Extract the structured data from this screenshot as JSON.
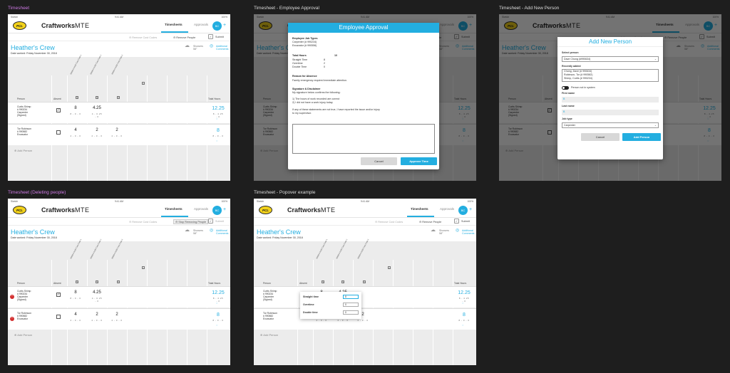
{
  "labels": {
    "f1": "Timesheet",
    "f2": "Timesheet - Employee Approval",
    "f3": "Timesheet - Add New Person",
    "f4": "Timesheet (Deleting people)",
    "f5": "Timesheet - Popover example"
  },
  "app": {
    "status_left": "Sketch",
    "status_time": "9:41 AM",
    "status_right": "100%",
    "logo": "PCL",
    "brand_bold": "Craftworks",
    "brand_light": "MTE",
    "tab_timesheets": "Timesheets",
    "tab_approvals": "Approvals",
    "avatar": "BC",
    "plus": "+"
  },
  "toolbar": {
    "remove_cost": "Remove Cost Codes",
    "remove_people": "Remove People",
    "stop_removing": "Stop Removing People",
    "submit": "Submit"
  },
  "crew": {
    "title": "Heather's Crew",
    "date": "Date worked: Friday November 30, 2018",
    "weather_1": "Showers",
    "weather_2": "58°",
    "comments_1": "Additional",
    "comments_2": "Comments"
  },
  "grid": {
    "person": "Person",
    "absent": "Absent",
    "total": "Total Hours",
    "cc1": "30MM-0-0100 Cost Code 1",
    "cc2": "30MM-0-0200 Cost Code 2",
    "cc3": "30MM-0-0300 Cost Code 3",
    "add_person": "Add Person"
  },
  "rows": [
    {
      "name": "Curtis Shimp",
      "id": "# 990234",
      "trade": "Carpenter",
      "note": "(Signed)",
      "absent": "✓",
      "v1": "8",
      "s1": "8 - 0 - 0",
      "v2": "4.25",
      "s2": "4 - 0.25 - 0",
      "total": "12.25",
      "stotal": "8 - 4.25 - 0"
    },
    {
      "name": "Tor Robinson",
      "id": "# 990582",
      "trade": "Excavator",
      "note": "",
      "absent": "",
      "v1": "4",
      "s1": "4 - 0 - 0",
      "v2": "2",
      "s2": "2 - 0 - 0",
      "v3": "2",
      "s3": "2 - 0 - 0",
      "total": "8",
      "stotal": "8 - 0 - 0"
    }
  ],
  "approval": {
    "title": "Employee Approval",
    "jobs_h": "Employee Job Types",
    "job1": "Carpenter (# 990234)",
    "job2": "Excavator (# 990556)",
    "total_h": "Total Hours",
    "total_v": "10",
    "st": "Straight Time",
    "st_v": "8",
    "ot": "Overtime",
    "ot_v": "2",
    "dt": "Double Time",
    "dt_v": "0",
    "reason_h": "Reason for Absence",
    "reason": "Family emergency required immediate attention.",
    "sig_h": "Signature & Disclaimer",
    "sig1": "My signature below confirms the following:",
    "sig2": "1) The hours of work recorded are correct",
    "sig3": "2) I did not have a work injury today",
    "sig4": "If any of these statements are not true, I have reported the issue and/or injury",
    "sig5": "to my supervisor.",
    "cancel": "Cancel",
    "approve": "Approve Time"
  },
  "addp": {
    "title": "Add New Person",
    "select_l": "Select person",
    "select_v": "Dave Chong (#990634)",
    "recent_l": "Recently added",
    "r1": "Chong, Dave (# 990634)",
    "r2": "Robinson, Tor (# 990582)",
    "r3": "Shimp, Curtis (# 990234)",
    "toggle": "Person not in system",
    "first_l": "First name",
    "first_v": "B",
    "last_l": "Last name",
    "last_v": "B",
    "job_l": "Job type",
    "job_v": "Carpenter",
    "cancel": "Cancel",
    "add": "Add Person"
  },
  "popover": {
    "st": "Straight time",
    "st_v": "8",
    "ot": "Overtime",
    "ot_v": "0",
    "dt": "Double time",
    "dt_v": "0"
  }
}
